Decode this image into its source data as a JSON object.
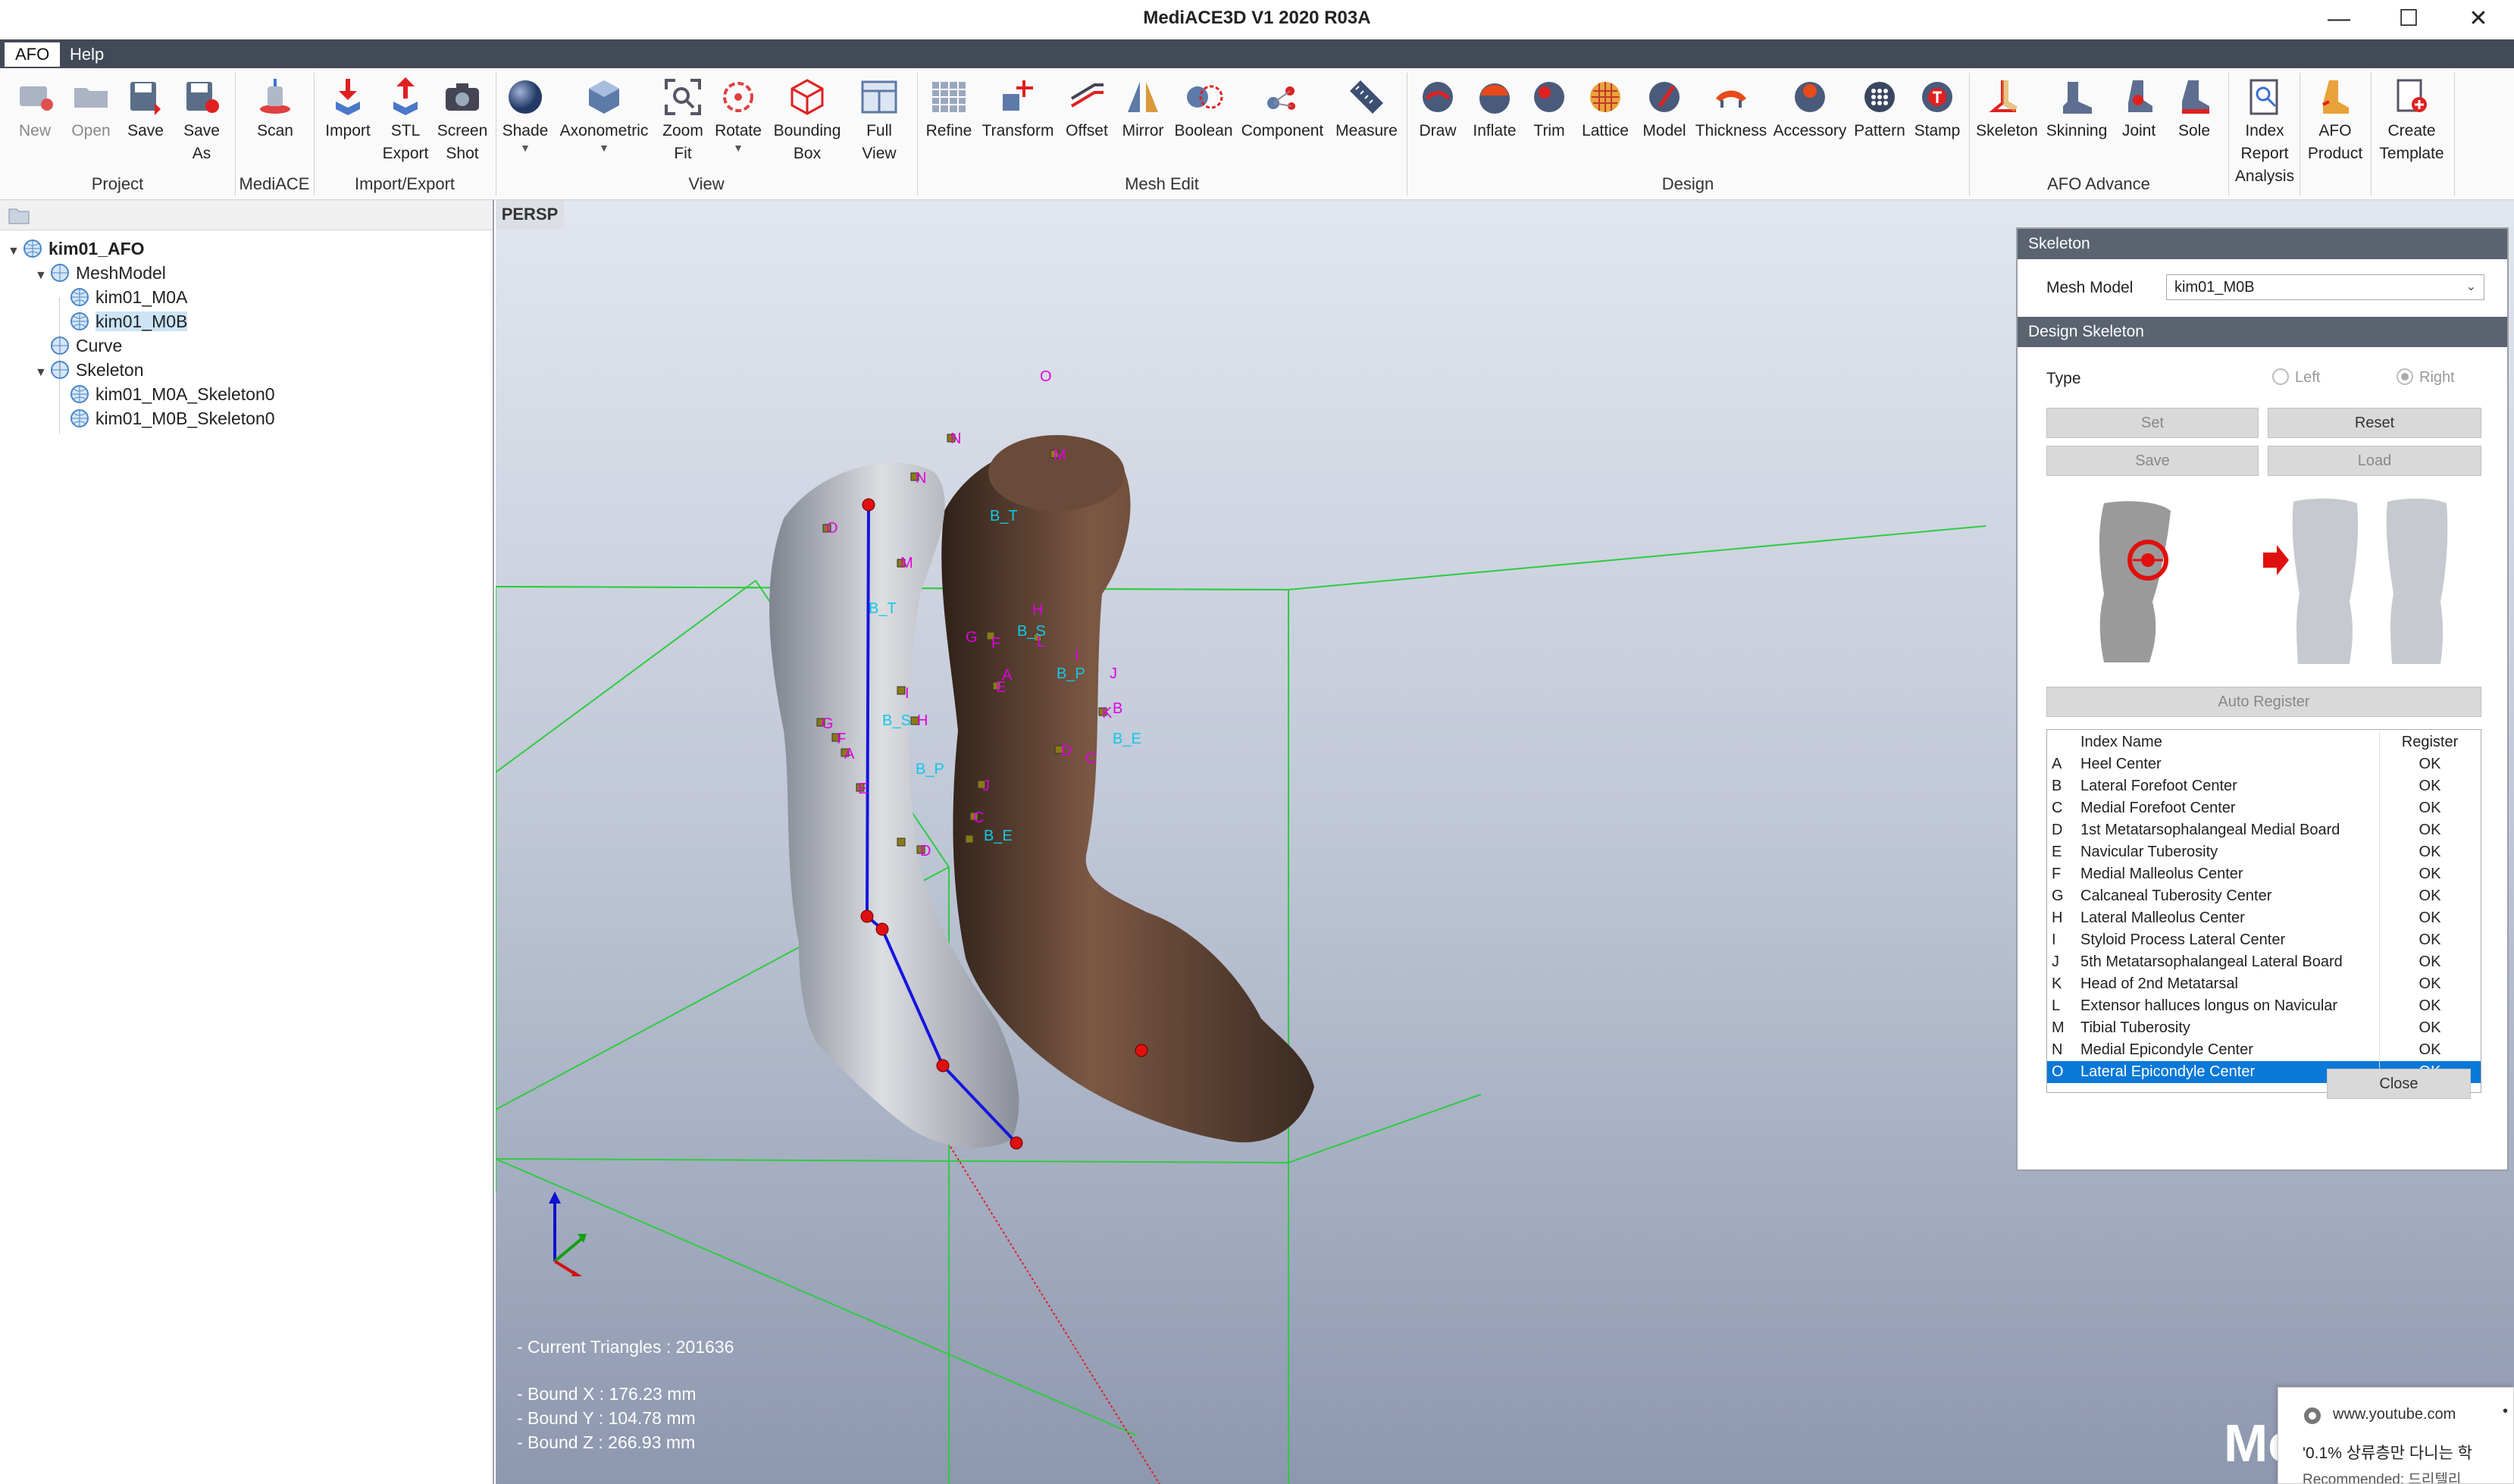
{
  "window": {
    "title": "MediACE3D V1 2020 R03A",
    "controls": [
      "—",
      "☐",
      "✕"
    ]
  },
  "menu": {
    "items": [
      "AFO",
      "Help"
    ]
  },
  "ribbon": {
    "buttons": {
      "new": "New",
      "open": "Open",
      "save": "Save",
      "save_as_1": "Save",
      "save_as_2": "As",
      "scan": "Scan",
      "import": "Import",
      "stl_1": "STL",
      "stl_2": "Export",
      "shot_1": "Screen",
      "shot_2": "Shot",
      "shade": "Shade",
      "axonometric": "Axonometric",
      "zoom_1": "Zoom",
      "zoom_2": "Fit",
      "rotate": "Rotate",
      "bbox_1": "Bounding",
      "bbox_2": "Box",
      "full_1": "Full",
      "full_2": "View",
      "refine": "Refine",
      "transform": "Transform",
      "offset": "Offset",
      "mirror": "Mirror",
      "boolean": "Boolean",
      "component": "Component",
      "measure": "Measure",
      "draw": "Draw",
      "inflate": "Inflate",
      "trim": "Trim",
      "lattice": "Lattice",
      "model": "Model",
      "thickness": "Thickness",
      "accessory": "Accessory",
      "pattern": "Pattern",
      "stamp": "Stamp",
      "skeleton": "Skeleton",
      "skinning": "Skinning",
      "joint": "Joint",
      "sole": "Sole",
      "index_1": "Index",
      "index_2": "Report",
      "index_3": "Analysis",
      "afo_1": "AFO",
      "afo_2": "Product",
      "create_1": "Create",
      "create_2": "Template"
    },
    "groups": {
      "project": "Project",
      "mediace": "MediACE",
      "import_export": "Import/Export",
      "view": "View",
      "mesh_edit": "Mesh Edit",
      "design": "Design",
      "afo_advance": "AFO Advance"
    }
  },
  "tree": {
    "root": "kim01_AFO",
    "mesh_model": "MeshModel",
    "m0a": "kim01_M0A",
    "m0b": "kim01_M0B",
    "curve": "Curve",
    "skeleton": "Skeleton",
    "sk_a": "kim01_M0A_Skeleton0",
    "sk_b": "kim01_M0B_Skeleton0"
  },
  "viewport": {
    "label": "PERSP",
    "triangles": "- Current Triangles : 201636",
    "bound_x": "- Bound X : 176.23 mm",
    "bound_y": "- Bound Y : 104.78 mm",
    "bound_z": "- Bound Z : 266.93 mm",
    "watermark": "Me",
    "bone_labels": {
      "bt1": "B_T",
      "bs1": "B_S",
      "bp1": "B_P",
      "be1": "B_E",
      "bt2": "B_T",
      "bs2": "B_S",
      "bp2": "B_P",
      "be2": "B_E"
    },
    "landmarks_right": [
      "O",
      "N",
      "M",
      "H",
      "G",
      "F",
      "L",
      "I",
      "A",
      "E",
      "J",
      "K",
      "B",
      "D",
      "C"
    ],
    "landmarks_left": [
      "N",
      "O",
      "M",
      "G",
      "I",
      "F",
      "H",
      "A",
      "E",
      "J",
      "C",
      "D"
    ]
  },
  "skeleton_panel": {
    "title": "Skeleton",
    "mesh_model_label": "Mesh Model",
    "mesh_model_value": "kim01_M0B",
    "design_title": "Design Skeleton",
    "type_label": "Type",
    "left": "Left",
    "right": "Right",
    "set": "Set",
    "reset": "Reset",
    "save": "Save",
    "load": "Load",
    "auto_register": "Auto Register",
    "col_index": "Index Name",
    "col_register": "Register",
    "rows": [
      {
        "id": "A",
        "name": "Heel Center",
        "reg": "OK"
      },
      {
        "id": "B",
        "name": "Lateral Forefoot Center",
        "reg": "OK"
      },
      {
        "id": "C",
        "name": "Medial Forefoot Center",
        "reg": "OK"
      },
      {
        "id": "D",
        "name": "1st Metatarsophalangeal Medial Board",
        "reg": "OK"
      },
      {
        "id": "E",
        "name": "Navicular Tuberosity",
        "reg": "OK"
      },
      {
        "id": "F",
        "name": "Medial Malleolus Center",
        "reg": "OK"
      },
      {
        "id": "G",
        "name": "Calcaneal Tuberosity Center",
        "reg": "OK"
      },
      {
        "id": "H",
        "name": "Lateral Malleolus Center",
        "reg": "OK"
      },
      {
        "id": "I",
        "name": "Styloid Process Lateral Center",
        "reg": "OK"
      },
      {
        "id": "J",
        "name": "5th Metatarsophalangeal Lateral Board",
        "reg": "OK"
      },
      {
        "id": "K",
        "name": "Head of 2nd Metatarsal",
        "reg": "OK"
      },
      {
        "id": "L",
        "name": "Extensor halluces longus on Navicular",
        "reg": "OK"
      },
      {
        "id": "M",
        "name": "Tibial Tuberosity",
        "reg": "OK"
      },
      {
        "id": "N",
        "name": "Medial Epicondyle Center",
        "reg": "OK"
      },
      {
        "id": "O",
        "name": "Lateral Epicondyle Center",
        "reg": "OK"
      }
    ],
    "close": "Close"
  },
  "notification": {
    "site": "www.youtube.com",
    "text": "'0.1% 상류층만 다니는 학",
    "sub": "Recommended: 드리텔리"
  },
  "colors": {
    "menubar": "#434a57",
    "panel_header": "#5b6370",
    "selection": "#0a78d7",
    "skeleton_line": "#1515e0",
    "joint": "#e01010",
    "label_magenta": "#e000e0",
    "label_cyan": "#10c8e8",
    "bbox_green": "#2ecc40"
  }
}
